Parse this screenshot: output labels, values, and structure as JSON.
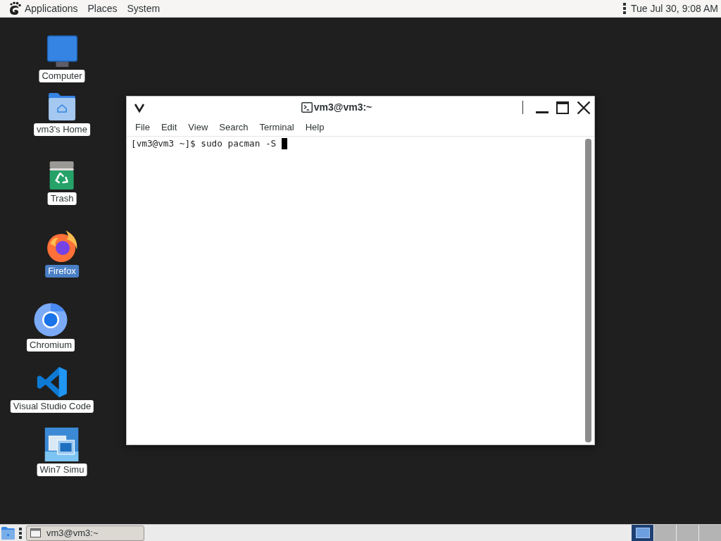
{
  "top_panel": {
    "menus": [
      "Applications",
      "Places",
      "System"
    ],
    "clock": "Tue Jul 30, 9:08 AM"
  },
  "desktop_icons": [
    {
      "label": "Computer",
      "kind": "computer",
      "selected": false
    },
    {
      "label": "vm3's Home",
      "kind": "home",
      "selected": false
    },
    {
      "label": "Trash",
      "kind": "trash",
      "selected": false
    },
    {
      "label": "Firefox",
      "kind": "firefox",
      "selected": true
    },
    {
      "label": "Chromium",
      "kind": "chromium",
      "selected": false
    },
    {
      "label": "Visual Studio Code",
      "kind": "vscode",
      "selected": false
    },
    {
      "label": "Win7 Simu",
      "kind": "win7",
      "selected": false
    }
  ],
  "terminal_window": {
    "title": "vm3@vm3:~",
    "menu": [
      "File",
      "Edit",
      "View",
      "Search",
      "Terminal",
      "Help"
    ],
    "lines": [
      "[vm3@vm3 ~]$ sudo pacman -S"
    ]
  },
  "bottom_panel": {
    "tasks": [
      {
        "label": "vm3@vm3:~",
        "selected": false
      }
    ],
    "workspaces": [
      {
        "selected": true
      },
      {
        "selected": false
      },
      {
        "selected": false
      },
      {
        "selected": false
      }
    ]
  }
}
